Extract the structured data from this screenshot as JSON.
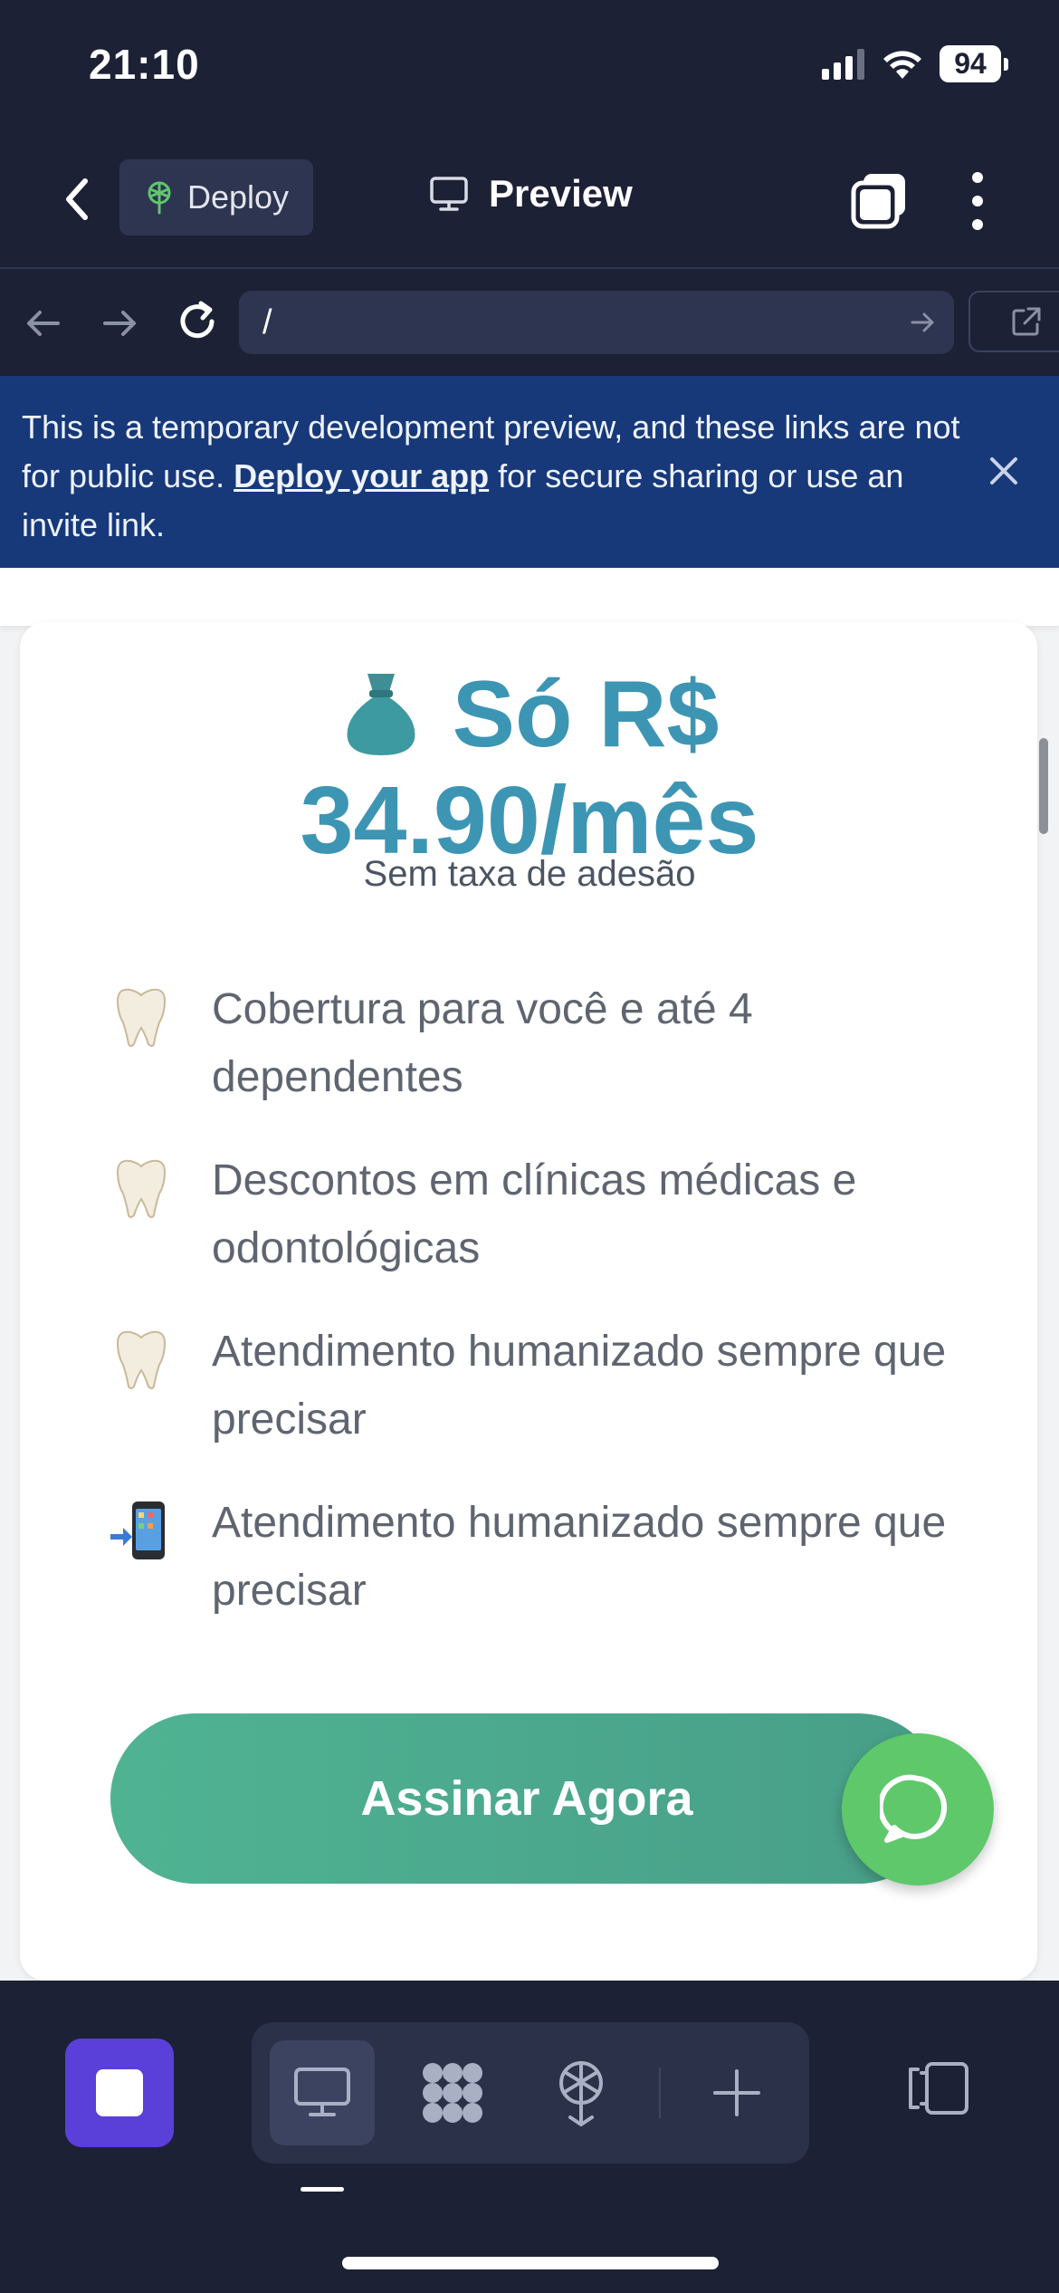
{
  "status_bar": {
    "time": "21:10",
    "battery": "94"
  },
  "app_bar": {
    "deploy_label": "Deploy",
    "preview_label": "Preview"
  },
  "browser": {
    "url": "/"
  },
  "banner": {
    "text_before": "This is a temporary development preview, and these links are not for public use. ",
    "link_text": "Deploy your app",
    "text_after": " for secure sharing or use an invite link."
  },
  "pricing": {
    "price_line1": "Só R$",
    "price_line2": "34.90/mês",
    "note": "Sem taxa de adesão"
  },
  "features": [
    {
      "icon": "tooth-icon",
      "text": "Cobertura para você e até 4 dependentes"
    },
    {
      "icon": "tooth-icon",
      "text": "Descontos em clínicas médicas e odontológicas"
    },
    {
      "icon": "tooth-icon",
      "text": "Atendimento humanizado sempre que precisar"
    },
    {
      "icon": "mobile-phone-arrow-icon",
      "text": "Atendimento humanizado sempre que precisar"
    }
  ],
  "cta": {
    "label": "Assinar Agora"
  },
  "colors": {
    "price": "#3d95b4",
    "cta_gradient_start": "#4fb392",
    "cta_gradient_end": "#489e88",
    "chat_button": "#5ec86b",
    "banner_bg": "#17397a",
    "app_bg": "#1c2135",
    "stop_button": "#5b3fd9"
  }
}
